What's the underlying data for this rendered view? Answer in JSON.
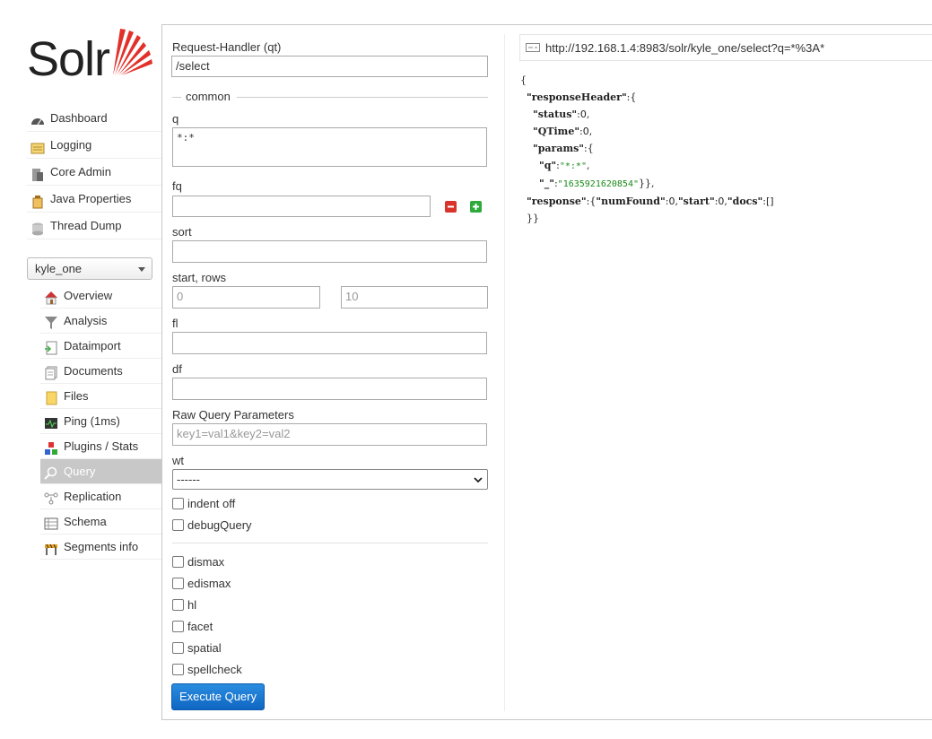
{
  "logo": {
    "text": "Solr"
  },
  "main_nav": [
    {
      "label": "Dashboard",
      "icon": "dashboard-icon"
    },
    {
      "label": "Logging",
      "icon": "logging-icon"
    },
    {
      "label": "Core Admin",
      "icon": "core-admin-icon"
    },
    {
      "label": "Java Properties",
      "icon": "java-properties-icon"
    },
    {
      "label": "Thread Dump",
      "icon": "thread-dump-icon"
    }
  ],
  "core_selector": {
    "value": "kyle_one"
  },
  "core_nav": [
    {
      "label": "Overview",
      "icon": "overview-icon"
    },
    {
      "label": "Analysis",
      "icon": "analysis-icon"
    },
    {
      "label": "Dataimport",
      "icon": "dataimport-icon"
    },
    {
      "label": "Documents",
      "icon": "documents-icon"
    },
    {
      "label": "Files",
      "icon": "files-icon"
    },
    {
      "label": "Ping (1ms)",
      "icon": "ping-icon"
    },
    {
      "label": "Plugins / Stats",
      "icon": "plugins-icon"
    },
    {
      "label": "Query",
      "icon": "query-icon",
      "active": true
    },
    {
      "label": "Replication",
      "icon": "replication-icon"
    },
    {
      "label": "Schema",
      "icon": "schema-icon"
    },
    {
      "label": "Segments info",
      "icon": "segments-icon"
    }
  ],
  "form": {
    "qt_label": "Request-Handler (qt)",
    "qt_value": "/select",
    "common_legend": "common",
    "q_label": "q",
    "q_value": "*:*",
    "fq_label": "fq",
    "fq_value": "",
    "sort_label": "sort",
    "sort_value": "",
    "start_rows_label": "start, rows",
    "start_placeholder": "0",
    "rows_placeholder": "10",
    "fl_label": "fl",
    "fl_value": "",
    "df_label": "df",
    "df_value": "",
    "raw_label": "Raw Query Parameters",
    "raw_placeholder": "key1=val1&key2=val2",
    "wt_label": "wt",
    "wt_value": "------",
    "indent_label": "indent off",
    "debug_label": "debugQuery",
    "dismax_label": "dismax",
    "edismax_label": "edismax",
    "hl_label": "hl",
    "facet_label": "facet",
    "spatial_label": "spatial",
    "spellcheck_label": "spellcheck",
    "execute_label": "Execute Query"
  },
  "result": {
    "url": "http://192.168.1.4:8983/solr/kyle_one/select?q=*%3A*",
    "json": {
      "open": "{",
      "responseHeader_key": "\"responseHeader\"",
      "status_key": "\"status\"",
      "status_val": "0",
      "qtime_key": "\"QTime\"",
      "qtime_val": "0",
      "params_key": "\"params\"",
      "q_key": "\"q\"",
      "q_val": "\"*:*\"",
      "underscore_key": "\"_\"",
      "underscore_val": "\"1635921620854\"",
      "response_key": "\"response\"",
      "numfound_key": "\"numFound\"",
      "numfound_val": "0",
      "start_key": "\"start\"",
      "start_val": "0",
      "docs_key": "\"docs\"",
      "docs_val": "[]",
      "close": "}}"
    }
  },
  "colors": {
    "accent": "#0f66c2",
    "active_nav": "#c8c8c8",
    "logo_red": "#e2302a"
  }
}
